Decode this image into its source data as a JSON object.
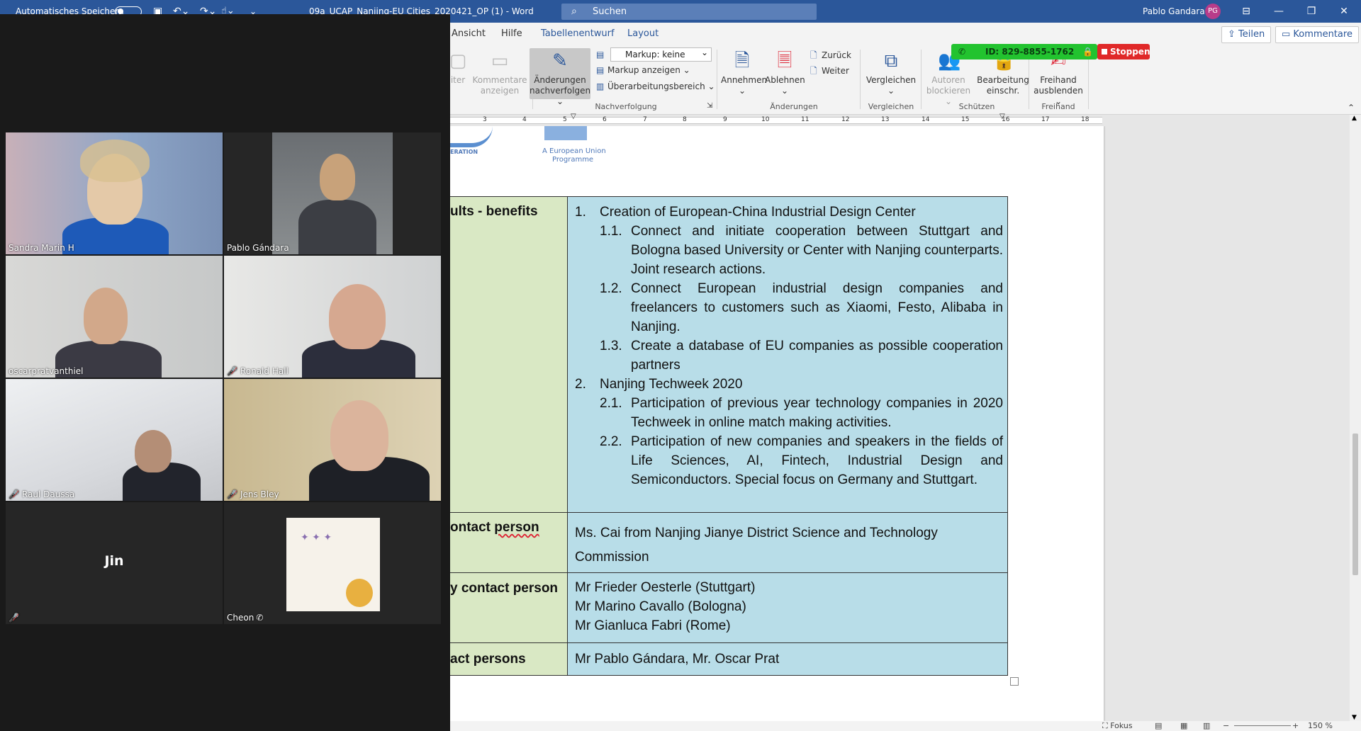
{
  "titlebar": {
    "autosave_label": "Automatisches Speichern",
    "doc_title": "09a_UCAP_Nanjing-EU Cities_2020421_OP (1)  -  Word",
    "search_placeholder": "Suchen",
    "user_name": "Pablo Gandara",
    "user_initials": "PG"
  },
  "tabs": [
    {
      "label": "Ansicht"
    },
    {
      "label": "Hilfe"
    },
    {
      "label": "Tabellenentwurf"
    },
    {
      "label": "Layout"
    }
  ],
  "share_button": "Teilen",
  "comments_button": "Kommentare",
  "ribbon": {
    "kommentare_anzeigen": [
      "Kommentare",
      "anzeigen"
    ],
    "aenderungen_nachverfolgen": [
      "Änderungen",
      "nachverfolgen"
    ],
    "markup_value": "Markup: keine",
    "markup_anzeigen": "Markup anzeigen",
    "ueberarbeitungsbereich": "Überarbeitungsbereich",
    "nachverfolgung_group": "Nachverfolgung",
    "annehmen": "Annehmen",
    "ablehnen": "Ablehnen",
    "zurueck": "Zurück",
    "weiter": "Weiter",
    "aenderungen_group": "Änderungen",
    "vergleichen": "Vergleichen",
    "vergleichen_group": "Vergleichen",
    "autoren_blockieren": [
      "Autoren",
      "blockieren"
    ],
    "bearbeitung_einschr": [
      "Bearbeitung",
      "einschr."
    ],
    "schuetzen_group": "Schützen",
    "freihand_ausblenden": [
      "Freihand",
      "ausblenden"
    ],
    "freihand_group": "Freihand",
    "partial_left": "iter"
  },
  "share_indicator": {
    "meeting_id": "ID: 829-8855-1762",
    "stop_label": "Stoppen"
  },
  "ruler_ticks": [
    "3",
    "4",
    "5",
    "6",
    "7",
    "8",
    "9",
    "10",
    "11",
    "12",
    "13",
    "14",
    "15",
    "16",
    "17",
    "18"
  ],
  "logos": {
    "left_partial": "ERATION",
    "right_line1": "A European Union",
    "right_line2": "Programme"
  },
  "document": {
    "row1_label": "ults - benefits",
    "item1": "Creation of European-China Industrial Design Center",
    "item1_1": "Connect and initiate cooperation between Stuttgart and Bologna based University or Center with Nanjing counterparts. Joint research actions.",
    "item1_2": "Connect European industrial design companies and freelancers to customers such as Xiaomi, Festo, Alibaba in Nanjing.",
    "item1_3": "Create a database of EU companies as possible cooperation partners",
    "item2": "Nanjing Techweek 2020",
    "item2_1": "Participation of previous year technology companies in 2020 Techweek in online match making activities.",
    "item2_2": "Participation of new companies and speakers in the fields of Life Sciences, AI, Fintech, Industrial Design and Semiconductors. Special focus on Germany and Stuttgart.",
    "n1": "1.",
    "n11": "1.1.",
    "n12": "1.2.",
    "n13": "1.3.",
    "n2": "2.",
    "n21": "2.1.",
    "n22": "2.2.",
    "row2_label_a": "ontact ",
    "row2_label_b": "person",
    "row2_value": "Ms. Cai from Nanjing Jianye District Science and Technology Commission",
    "row3_label": "y contact person",
    "row3_values": [
      "Mr Frieder Oesterle (Stuttgart)",
      "Mr Marino Cavallo (Bologna)",
      "Mr Gianluca Fabri (Rome)"
    ],
    "row4_label": "act persons",
    "row4_value": "Mr Pablo Gándara, Mr. Oscar Prat"
  },
  "statusbar": {
    "focus": "Fokus",
    "zoom": "150 %"
  },
  "participants": [
    {
      "name": "Sandra Marin H",
      "muted": false,
      "active": true
    },
    {
      "name": "Pablo Gándara",
      "muted": false,
      "active": false
    },
    {
      "name": "oscarpratvanthiel",
      "muted": false,
      "active": false
    },
    {
      "name": "Ronald Hall",
      "muted": true,
      "active": false
    },
    {
      "name": "Raul Daussa",
      "muted": true,
      "active": false
    },
    {
      "name": "Jens Bley",
      "muted": true,
      "active": false
    },
    {
      "name": "Jin",
      "muted": true,
      "active": false
    },
    {
      "name": "Cheon",
      "muted": false,
      "active": false
    }
  ],
  "colors": {
    "word_blue": "#2b579a",
    "label_cell": "#d9e8c4",
    "value_cell": "#b8dde8",
    "active_speaker": "#e6ea6d",
    "meeting_green": "#22c32f",
    "stop_red": "#e02828"
  }
}
